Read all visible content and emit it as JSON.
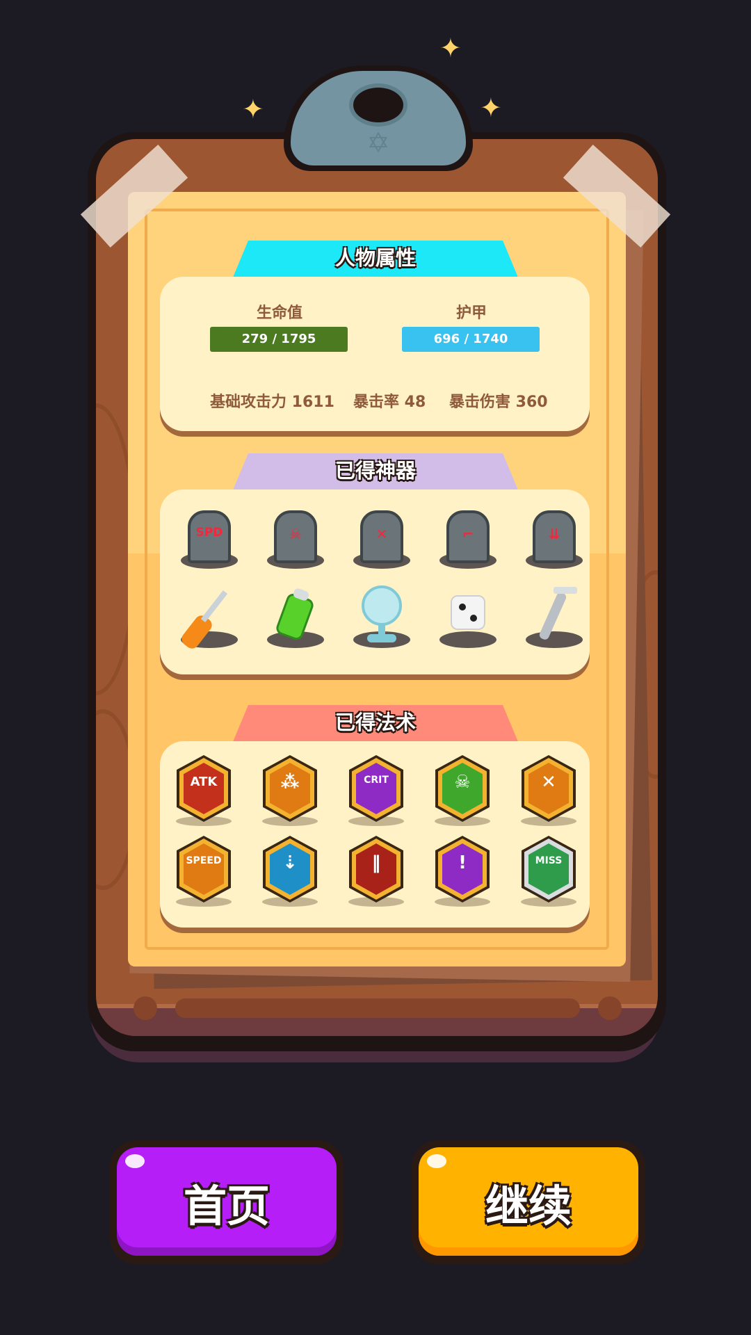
{
  "stats_section": {
    "title": "人物属性",
    "hp": {
      "label": "生命值",
      "value_text": "279 / 1795",
      "current": 279,
      "max": 1795
    },
    "armor": {
      "label": "护甲",
      "value_text": "696 / 1740",
      "current": 696,
      "max": 1740
    },
    "base_attack": "基础攻击力 1611",
    "crit_rate": "暴击率 48",
    "crit_damage": "暴击伤害 360"
  },
  "artifacts_section": {
    "title": "已得神器",
    "items": [
      {
        "icon": "speed-tombstone-icon",
        "glyph": "SPD"
      },
      {
        "icon": "skull-flame-tombstone-icon"
      },
      {
        "icon": "crossed-arrows-tombstone-icon"
      },
      {
        "icon": "boot-tombstone-icon"
      },
      {
        "icon": "impact-tombstone-icon"
      },
      {
        "icon": "screwdriver-icon"
      },
      {
        "icon": "battery-icon"
      },
      {
        "icon": "fan-icon"
      },
      {
        "icon": "dice-icon"
      },
      {
        "icon": "razor-icon"
      }
    ]
  },
  "spells_section": {
    "title": "已得法术",
    "items": [
      {
        "icon": "atk-up-badge-icon",
        "glyph": "ATK",
        "color": "#c3301b"
      },
      {
        "icon": "triple-shot-badge-icon",
        "color": "#e07a12"
      },
      {
        "icon": "crit-badge-icon",
        "glyph": "CRIT",
        "color": "#8e2bc4"
      },
      {
        "icon": "poison-skull-badge-icon",
        "color": "#3fa82c"
      },
      {
        "icon": "crossed-swords-badge-icon",
        "color": "#e07a12"
      },
      {
        "icon": "speed-up-badge-icon",
        "glyph": "SPEED",
        "color": "#e07a12"
      },
      {
        "icon": "pierce-badge-icon",
        "color": "#1f8fc8"
      },
      {
        "icon": "double-shot-badge-icon",
        "color": "#a8221a"
      },
      {
        "icon": "purple-shot-badge-icon",
        "color": "#8e2bc4"
      },
      {
        "icon": "miss-badge-icon",
        "glyph": "MISS",
        "color": "#2e9c4a"
      }
    ]
  },
  "buttons": {
    "home": {
      "label": "首页",
      "color": "#b51ef7"
    },
    "continue": {
      "label": "继续",
      "color": "#ffb300"
    }
  }
}
